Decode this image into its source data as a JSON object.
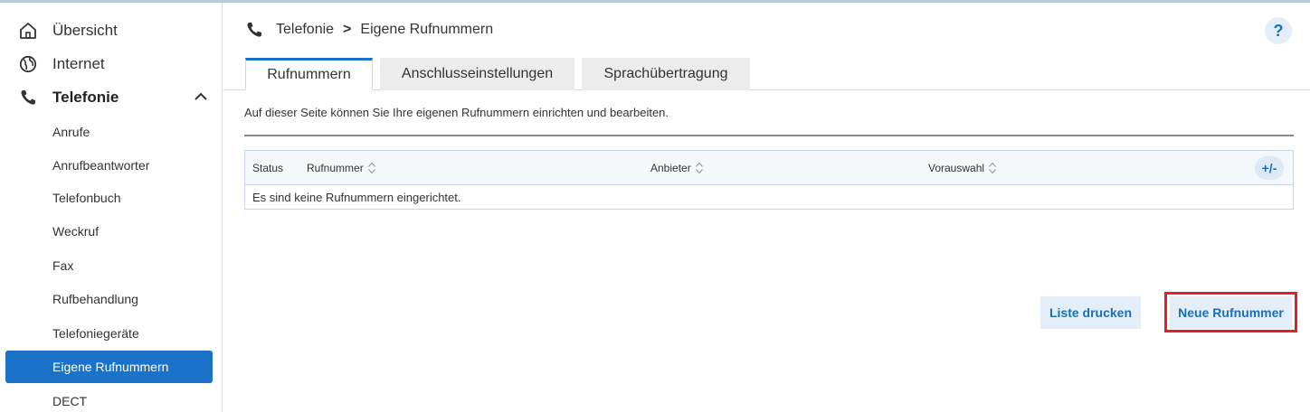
{
  "sidebar": {
    "main_items": [
      {
        "label": "Übersicht"
      },
      {
        "label": "Internet"
      },
      {
        "label": "Telefonie"
      }
    ],
    "sub_items": [
      {
        "label": "Anrufe"
      },
      {
        "label": "Anrufbeantworter"
      },
      {
        "label": "Telefonbuch"
      },
      {
        "label": "Weckruf"
      },
      {
        "label": "Fax"
      },
      {
        "label": "Rufbehandlung"
      },
      {
        "label": "Telefoniegeräte"
      },
      {
        "label": "Eigene Rufnummern"
      },
      {
        "label": "DECT"
      }
    ],
    "selected": "Eigene Rufnummern"
  },
  "breadcrumb": {
    "section": "Telefonie",
    "separator": ">",
    "page": "Eigene Rufnummern"
  },
  "help": {
    "label": "?"
  },
  "tabs": [
    {
      "label": "Rufnummern"
    },
    {
      "label": "Anschlusseinstellungen"
    },
    {
      "label": "Sprachübertragung"
    }
  ],
  "intro_text": "Auf dieser Seite können Sie Ihre eigenen Rufnummern einrichten und bearbeiten.",
  "table": {
    "columns": [
      {
        "label": "Status"
      },
      {
        "label": "Rufnummer"
      },
      {
        "label": "Anbieter"
      },
      {
        "label": "Vorauswahl"
      }
    ],
    "add_column_label": "+/-",
    "empty_message": "Es sind keine Rufnummern eingerichtet."
  },
  "buttons": {
    "print_list": "Liste drucken",
    "new_number": "Neue Rufnummer"
  },
  "colors": {
    "accent": "#1a73c9",
    "button_bg": "#e4eef8",
    "button_text": "#1a6fb5",
    "highlight": "#e01f26"
  }
}
